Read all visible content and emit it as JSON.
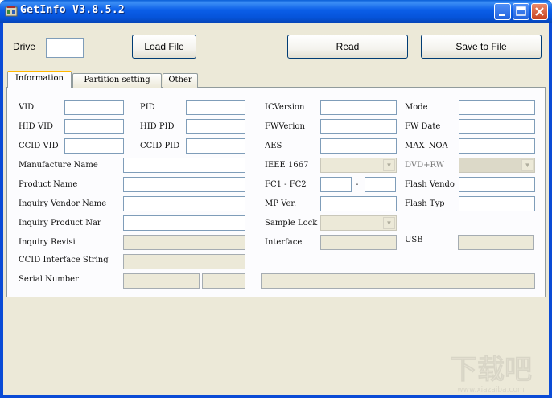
{
  "window": {
    "title": "GetInfo V3.8.5.2"
  },
  "toolbar": {
    "drive_label": "Drive",
    "drive_value": "",
    "load_file": "Load File",
    "read": "Read",
    "save_to_file": "Save to File"
  },
  "tabs": [
    "Information",
    "Partition setting",
    "Other"
  ],
  "labels": {
    "vid": "VID",
    "pid": "PID",
    "icversion": "ICVersion",
    "mode": "Mode",
    "hid_vid": "HID VID",
    "hid_pid": "HID PID",
    "fwverion": "FWVerion",
    "fw_date": "FW Date",
    "ccid_vid": "CCID VID",
    "ccid_pid": "CCID PID",
    "aes": "AES",
    "max_noa": "MAX_NOA",
    "manufacture_name": "Manufacture Name",
    "ieee_1667": "IEEE 1667",
    "dvd_rw": "DVD+RW",
    "product_name": "Product Name",
    "fc1_fc2": "FC1 - FC2",
    "fc_sep": "-",
    "flash_vendor": "Flash Vendo",
    "inquiry_vendor_name": "Inquiry Vendor Name",
    "mp_ver": "MP Ver.",
    "flash_type": "Flash Typ",
    "inquiry_product_name": "Inquiry Product Nar",
    "sample_lock": "Sample Lock",
    "inquiry_revision": "Inquiry Revisi",
    "interface": "Interface",
    "usb": "USB",
    "ccid_interface_string": "CCID Interface String",
    "serial_number": "Serial Number"
  },
  "watermark": {
    "text": "下载吧",
    "url": "www.xiazaiba.com"
  },
  "colors": {
    "title_bar": "#0553d9",
    "dialog_bg": "#ece9d8",
    "tab_highlight": "#ffb700"
  }
}
